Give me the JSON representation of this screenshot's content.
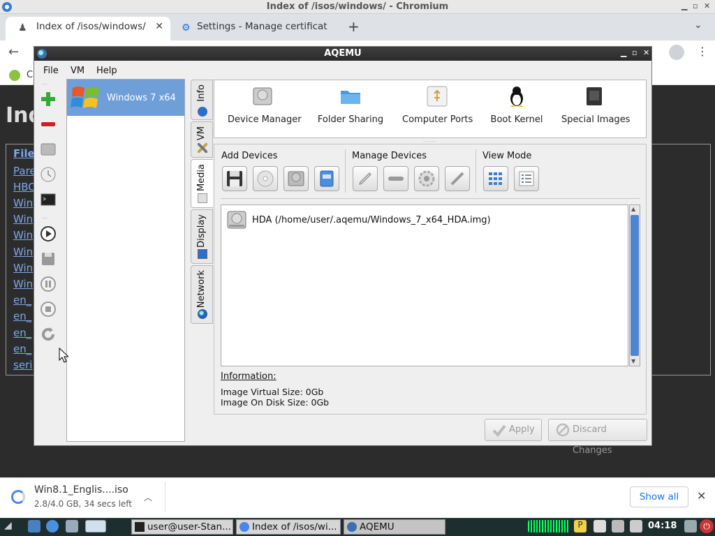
{
  "chromium": {
    "window_title": "Index of /isos/windows/ - Chromium",
    "tabs": [
      {
        "label": "Index of /isos/windows/",
        "active": true
      },
      {
        "label": "Settings - Manage certificat",
        "active": false
      }
    ],
    "bookmark_partial": "C",
    "page": {
      "heading": "Ind",
      "col_header": "File",
      "links": [
        "Pare",
        "HBC",
        "Win",
        "Win",
        "Win",
        "Win",
        "Win",
        "Win",
        "en_",
        "en_",
        "en_",
        "en_",
        "seri"
      ]
    }
  },
  "download": {
    "file_name": "Win8.1_Englis....iso",
    "status": "2.8/4.0 GB, 34 secs left",
    "show_all_label": "Show all"
  },
  "taskbar": {
    "items": [
      {
        "label": "user@user-Stan..."
      },
      {
        "label": "Index of /isos/wi..."
      },
      {
        "label": "AQEMU"
      }
    ],
    "clock": "04:18"
  },
  "aqemu": {
    "title": "AQEMU",
    "menu": [
      "File",
      "VM",
      "Help"
    ],
    "vm_name": "Windows 7 x64",
    "side_tabs": [
      "Info",
      "VM",
      "Media",
      "Display",
      "Network"
    ],
    "device_buttons": [
      "Device Manager",
      "Folder Sharing",
      "Computer Ports",
      "Boot Kernel",
      "Special Images"
    ],
    "groups": {
      "add": "Add Devices",
      "manage": "Manage Devices",
      "view": "View Mode"
    },
    "device_item": "HDA (/home/user/.aqemu/Windows_7_x64_HDA.img)",
    "info": {
      "header": "Information:",
      "virtual_size": "Image Virtual Size: 0Gb",
      "disk_size": "Image On Disk Size: 0Gb"
    },
    "buttons": {
      "apply": "Apply",
      "discard": "Discard Changes"
    }
  }
}
